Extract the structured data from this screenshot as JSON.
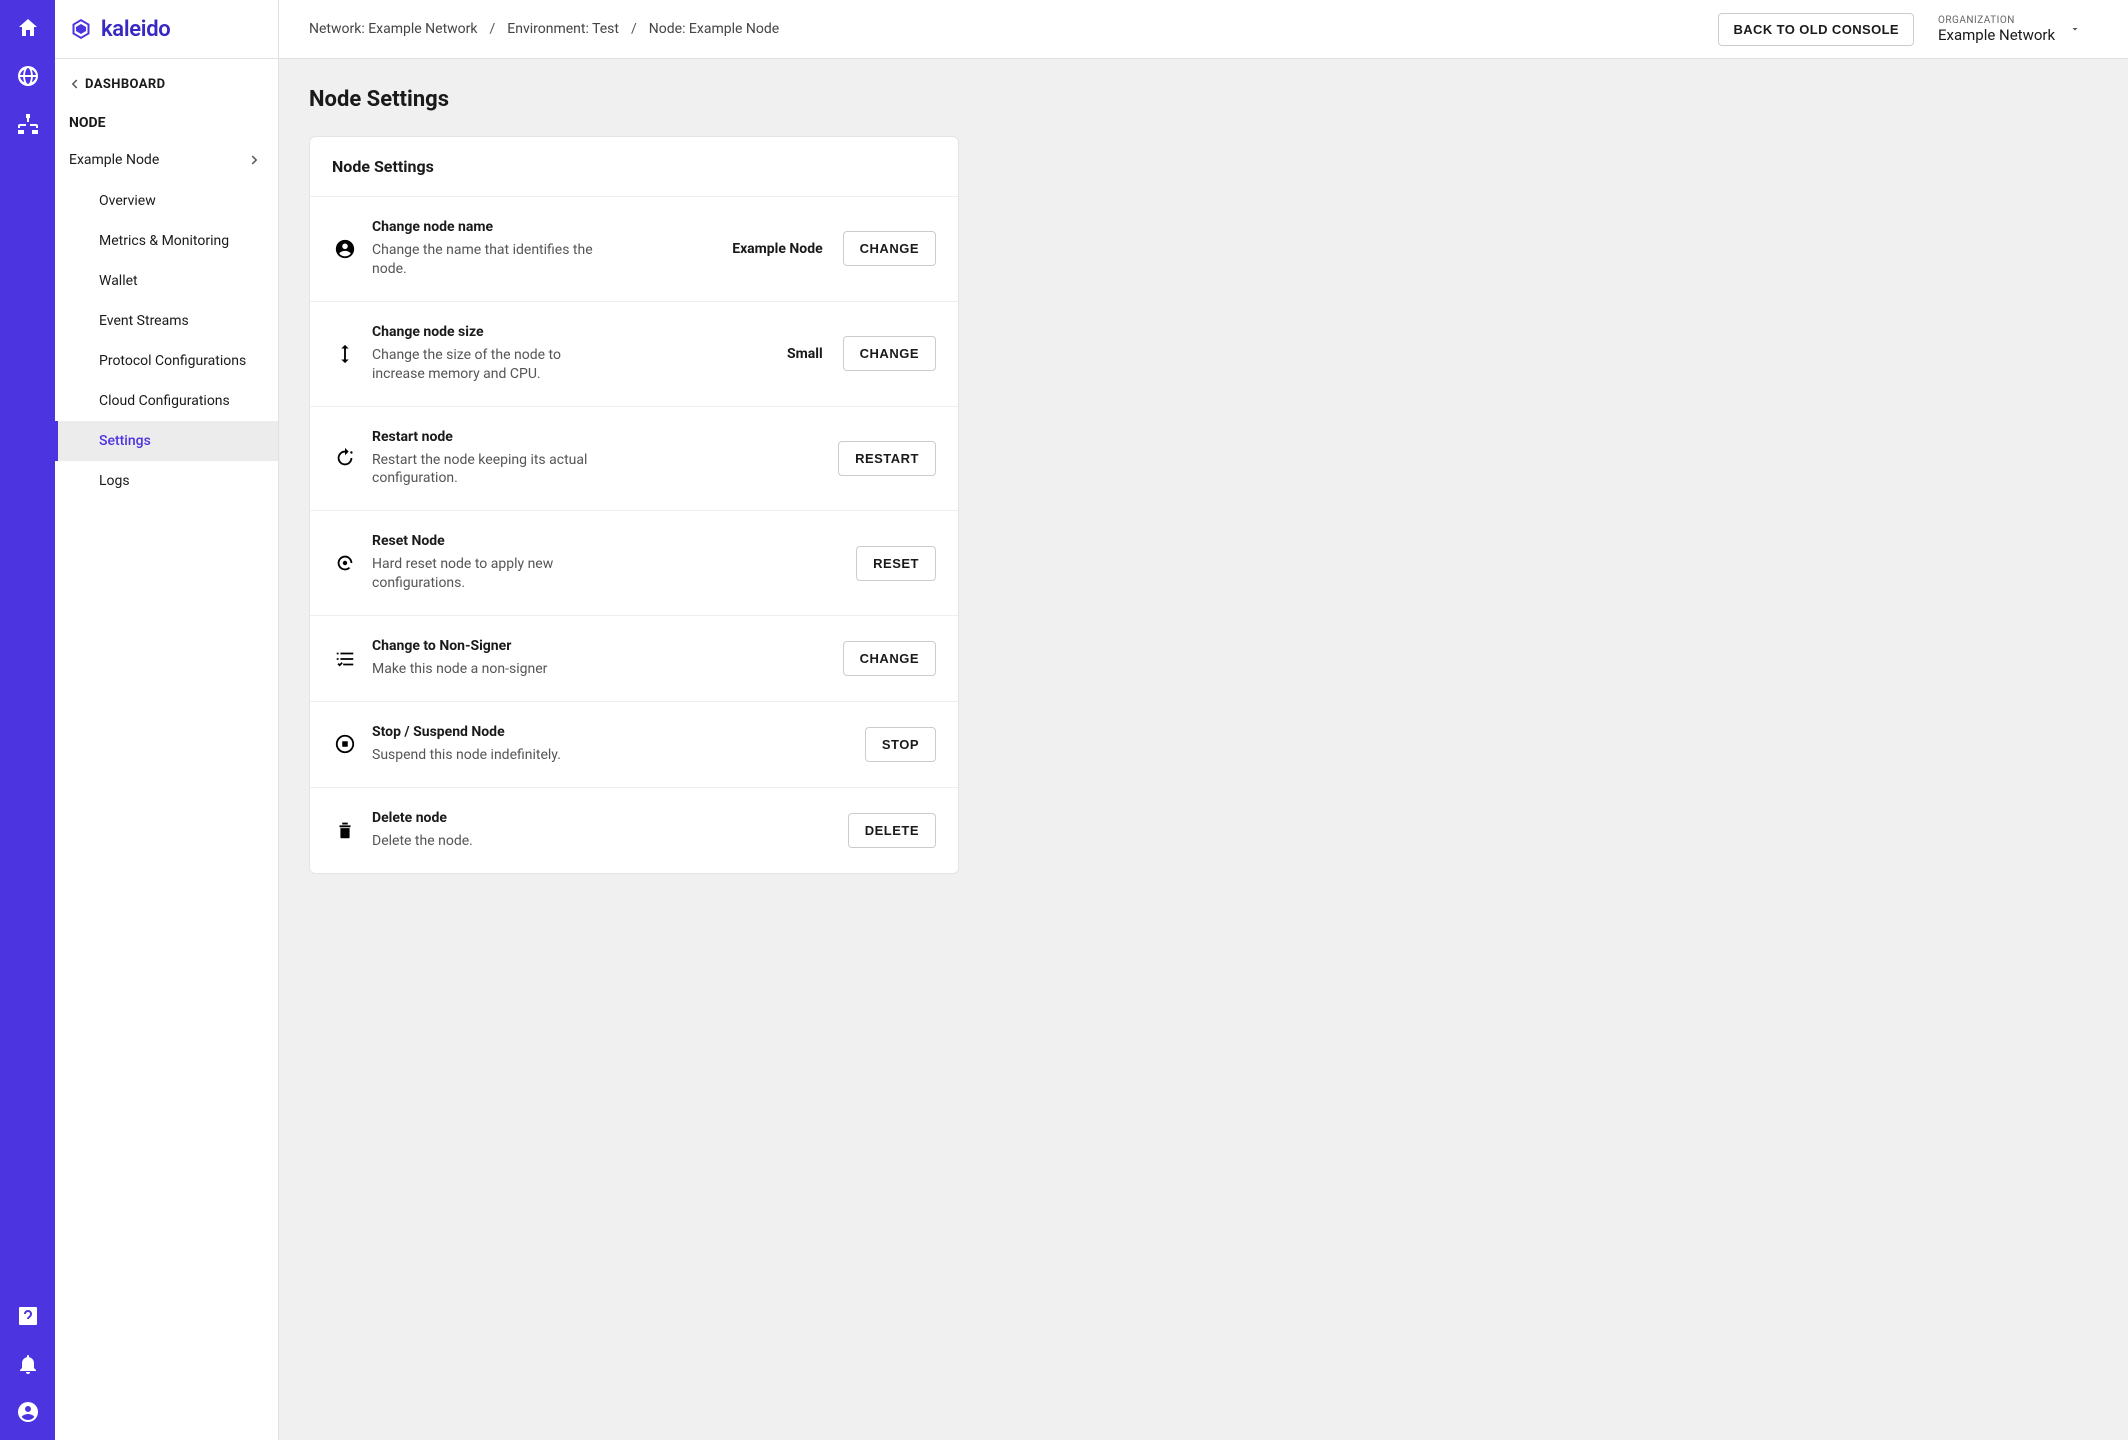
{
  "brand": "kaleido",
  "back_link": "DASHBOARD",
  "section_label": "NODE",
  "node_name_header": "Example Node",
  "nav": {
    "items": [
      "Overview",
      "Metrics & Monitoring",
      "Wallet",
      "Event Streams",
      "Protocol Configurations",
      "Cloud Configurations",
      "Settings",
      "Logs"
    ],
    "active_index": 6
  },
  "crumbs": [
    "Network: Example Network",
    "Environment: Test",
    "Node: Example Node"
  ],
  "old_console_btn": "BACK TO OLD CONSOLE",
  "org": {
    "label": "ORGANIZATION",
    "name": "Example Network"
  },
  "page_title": "Node Settings",
  "card_header": "Node Settings",
  "rows": [
    {
      "icon": "person",
      "title": "Change node name",
      "desc": "Change the name that identifies the node.",
      "value": "Example Node",
      "button": "CHANGE"
    },
    {
      "icon": "resize",
      "title": "Change node size",
      "desc": "Change the size of the node to increase memory and CPU.",
      "value": "Small",
      "button": "CHANGE"
    },
    {
      "icon": "restart",
      "title": "Restart node",
      "desc": "Restart the node keeping its actual configuration.",
      "value": null,
      "button": "RESTART"
    },
    {
      "icon": "reset",
      "title": "Reset Node",
      "desc": "Hard reset node to apply new configurations.",
      "value": null,
      "button": "RESET"
    },
    {
      "icon": "checklist",
      "title": "Change to Non-Signer",
      "desc": "Make this node a non-signer",
      "value": null,
      "button": "CHANGE"
    },
    {
      "icon": "stop",
      "title": "Stop / Suspend Node",
      "desc": "Suspend this node indefinitely.",
      "value": null,
      "button": "STOP"
    },
    {
      "icon": "delete",
      "title": "Delete node",
      "desc": "Delete the node.",
      "value": null,
      "button": "DELETE"
    }
  ]
}
